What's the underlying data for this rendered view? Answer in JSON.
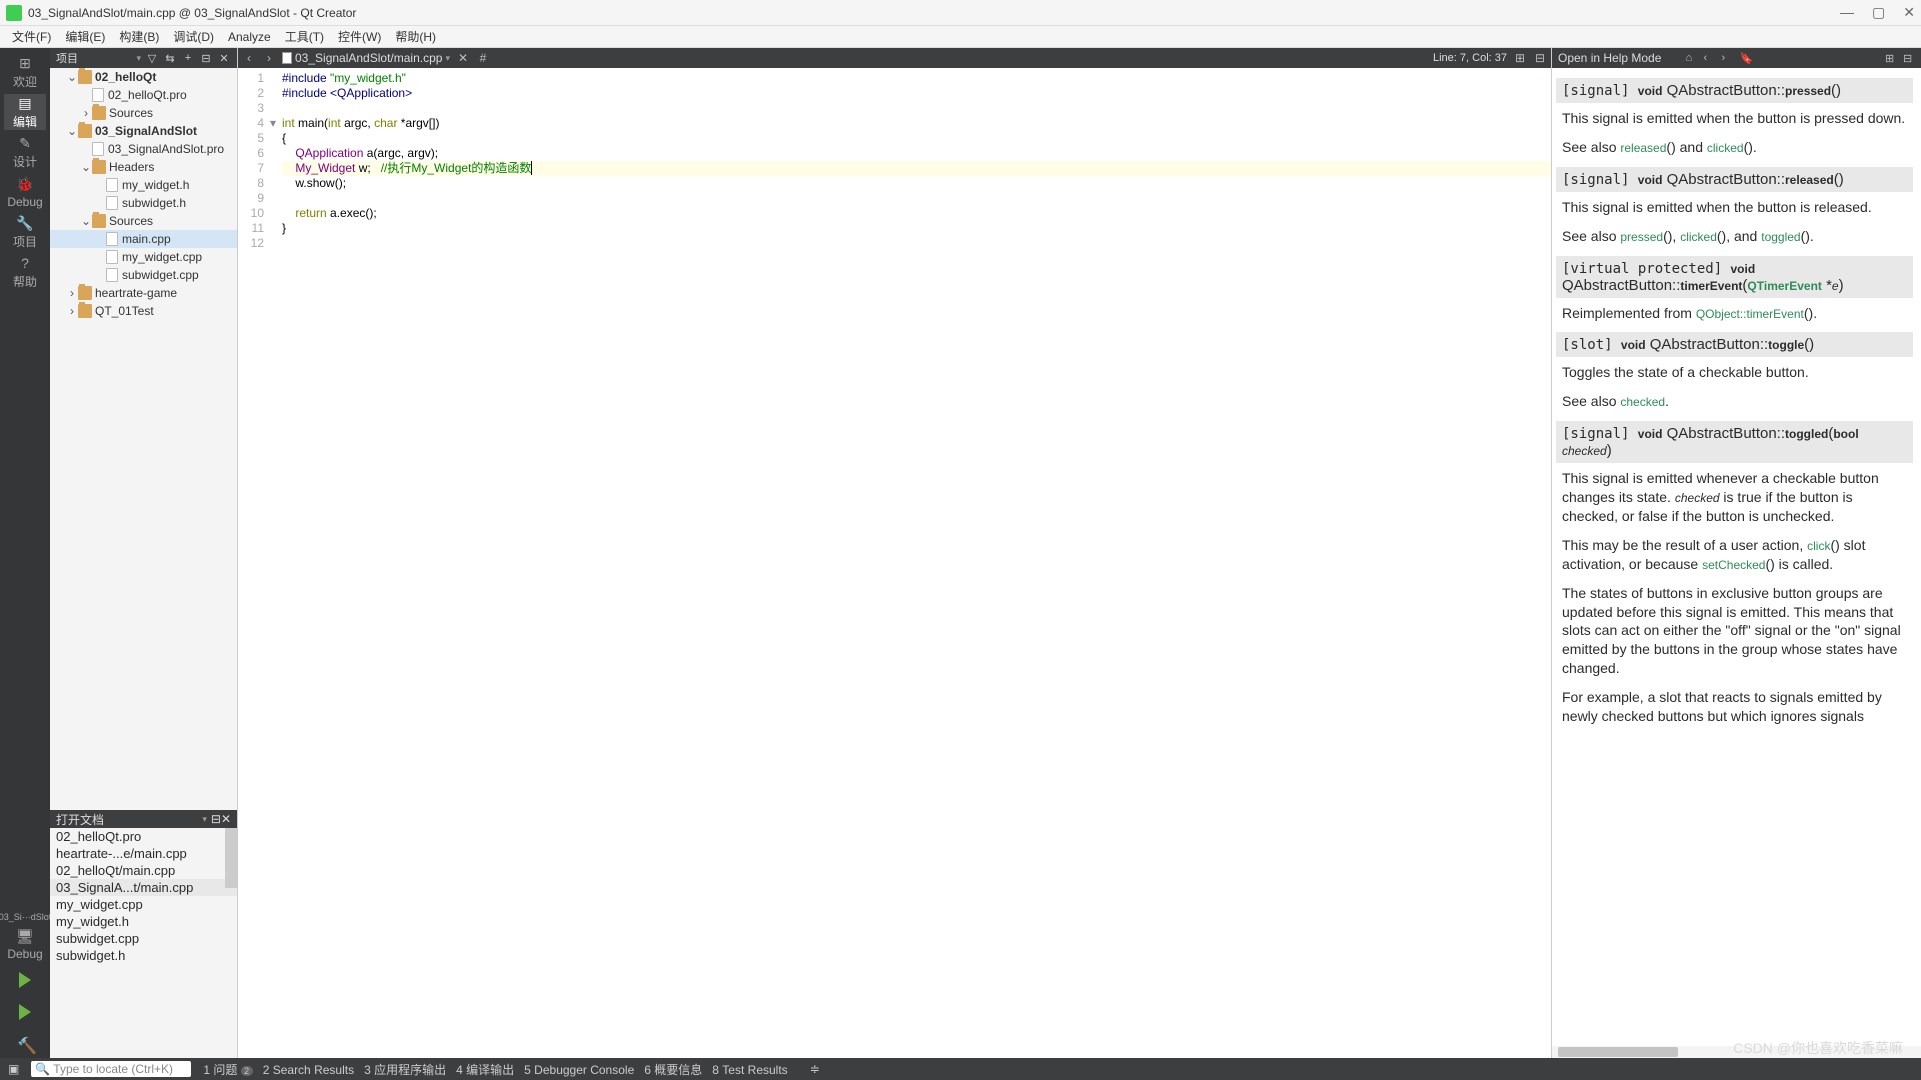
{
  "window": {
    "title": "03_SignalAndSlot/main.cpp @ 03_SignalAndSlot - Qt Creator"
  },
  "menu": [
    "文件(F)",
    "编辑(E)",
    "构建(B)",
    "调试(D)",
    "Analyze",
    "工具(T)",
    "控件(W)",
    "帮助(H)"
  ],
  "leftbar": {
    "items": [
      {
        "label": "欢迎",
        "icon": "⊞"
      },
      {
        "label": "编辑",
        "icon": "▤",
        "active": true
      },
      {
        "label": "设计",
        "icon": "✎"
      },
      {
        "label": "Debug",
        "icon": "🐞"
      },
      {
        "label": "项目",
        "icon": "🔧"
      },
      {
        "label": "帮助",
        "icon": "?"
      }
    ],
    "kit": "03_Si···dSlot",
    "debug": "Debug"
  },
  "project_panel": {
    "title": "项目"
  },
  "tree": [
    {
      "d": 1,
      "exp": "v",
      "fold": true,
      "bold": true,
      "lbl": "02_helloQt"
    },
    {
      "d": 2,
      "exp": "",
      "file": true,
      "lbl": "02_helloQt.pro"
    },
    {
      "d": 2,
      "exp": ">",
      "fold": true,
      "lbl": "Sources"
    },
    {
      "d": 1,
      "exp": "v",
      "fold": true,
      "bold": true,
      "lbl": "03_SignalAndSlot"
    },
    {
      "d": 2,
      "exp": "",
      "file": true,
      "lbl": "03_SignalAndSlot.pro"
    },
    {
      "d": 2,
      "exp": "v",
      "fold": true,
      "lbl": "Headers"
    },
    {
      "d": 3,
      "exp": "",
      "file": true,
      "lbl": "my_widget.h"
    },
    {
      "d": 3,
      "exp": "",
      "file": true,
      "lbl": "subwidget.h"
    },
    {
      "d": 2,
      "exp": "v",
      "fold": true,
      "lbl": "Sources"
    },
    {
      "d": 3,
      "exp": "",
      "file": true,
      "lbl": "main.cpp",
      "sel": true
    },
    {
      "d": 3,
      "exp": "",
      "file": true,
      "lbl": "my_widget.cpp"
    },
    {
      "d": 3,
      "exp": "",
      "file": true,
      "lbl": "subwidget.cpp"
    },
    {
      "d": 1,
      "exp": ">",
      "fold": true,
      "lbl": "heartrate-game"
    },
    {
      "d": 1,
      "exp": ">",
      "fold": true,
      "lbl": "QT_01Test"
    }
  ],
  "openfiles": {
    "title": "打开文档",
    "list": [
      "02_helloQt.pro",
      "heartrate-...e/main.cpp",
      "02_helloQt/main.cpp",
      "03_SignalA...t/main.cpp",
      "my_widget.cpp",
      "my_widget.h",
      "subwidget.cpp",
      "subwidget.h"
    ],
    "selected": 3
  },
  "editor": {
    "path": "03_SignalAndSlot/main.cpp",
    "linecol": "Line: 7, Col: 37",
    "hash": "#",
    "lines": [
      {
        "n": 1,
        "html": "<span class='pp'>#include</span> <span class='str'>\"my_widget.h\"</span>"
      },
      {
        "n": 2,
        "html": "<span class='pp'>#include</span> <span class='pp'>&lt;QApplication&gt;</span>"
      },
      {
        "n": 3,
        "html": ""
      },
      {
        "n": 4,
        "html": "<span class='kw'>int</span> <span class='id'>main</span>(<span class='kw'>int</span> argc, <span class='kw'>char</span> *argv[])",
        "fold": "v"
      },
      {
        "n": 5,
        "html": "{"
      },
      {
        "n": 6,
        "html": "    <span class='ty'>QApplication</span> a(argc, argv);"
      },
      {
        "n": 7,
        "html": "    <span class='ty'>My_Widget</span> w;   <span class='cm'>//执行My_Widget的构造函数</span><span class='cursor'></span>",
        "cur": true
      },
      {
        "n": 8,
        "html": "    w.<span class='id'>show</span>();"
      },
      {
        "n": 9,
        "html": ""
      },
      {
        "n": 10,
        "html": "    <span class='kw'>return</span> a.<span class='id'>exec</span>();"
      },
      {
        "n": 11,
        "html": "}"
      },
      {
        "n": 12,
        "html": ""
      }
    ]
  },
  "help": {
    "header": "Open in Help Mode",
    "sections": [
      {
        "sig": "[signal]",
        "ret": "void",
        "cls": "QAbstractButton::",
        "name": "pressed",
        "args": "()",
        "body": [
          "This signal is emitted when the button is pressed down.",
          "See also <span class='lnk'>released</span>() and <span class='lnk'>clicked</span>()."
        ]
      },
      {
        "sig": "[signal]",
        "ret": "void",
        "cls": "QAbstractButton::",
        "name": "released",
        "args": "()",
        "body": [
          "This signal is emitted when the button is released.",
          "See also <span class='lnk'>pressed</span>(), <span class='lnk'>clicked</span>(), and <span class='lnk'>toggled</span>()."
        ]
      },
      {
        "sig": "[virtual protected]",
        "ret": "void",
        "cls": "QAbstractButton::",
        "name": "timerEvent",
        "args": "(<span class='lnk bold'>QTimerEvent</span> *<span class='it'>e</span>)",
        "body": [
          "Reimplemented from <span class='lnk'>QObject::timerEvent</span>()."
        ]
      },
      {
        "sig": "[slot]",
        "ret": "void",
        "cls": "QAbstractButton::",
        "name": "toggle",
        "args": "()",
        "body": [
          "Toggles the state of a checkable button.",
          "See also <span class='lnk'>checked</span>."
        ]
      },
      {
        "sig": "[signal]",
        "ret": "void",
        "cls": "QAbstractButton::",
        "name": "toggled",
        "args": "(<span class='bold'>bool</span> <span class='it'>checked</span>)",
        "body": [
          "This signal is emitted whenever a checkable button changes its state. <span class='it'>checked</span> is true if the button is checked, or false if the button is unchecked.",
          "This may be the result of a user action, <span class='lnk'>click</span>() slot activation, or because <span class='lnk'>setChecked</span>() is called.",
          "The states of buttons in exclusive button groups are updated before this signal is emitted. This means that slots can act on either the \"off\" signal or the \"on\" signal emitted by the buttons in the group whose states have changed.",
          "For example, a slot that reacts to signals emitted by newly checked buttons but which ignores signals"
        ]
      }
    ]
  },
  "status": {
    "search_ph": "Type to locate (Ctrl+K)",
    "tabs": [
      "1  问题",
      "2  Search Results",
      "3  应用程序输出",
      "4  编译输出",
      "5  Debugger Console",
      "6  概要信息",
      "8  Test Results"
    ],
    "badge": "2"
  },
  "watermark": "CSDN @你也喜欢吃香菜嘛"
}
